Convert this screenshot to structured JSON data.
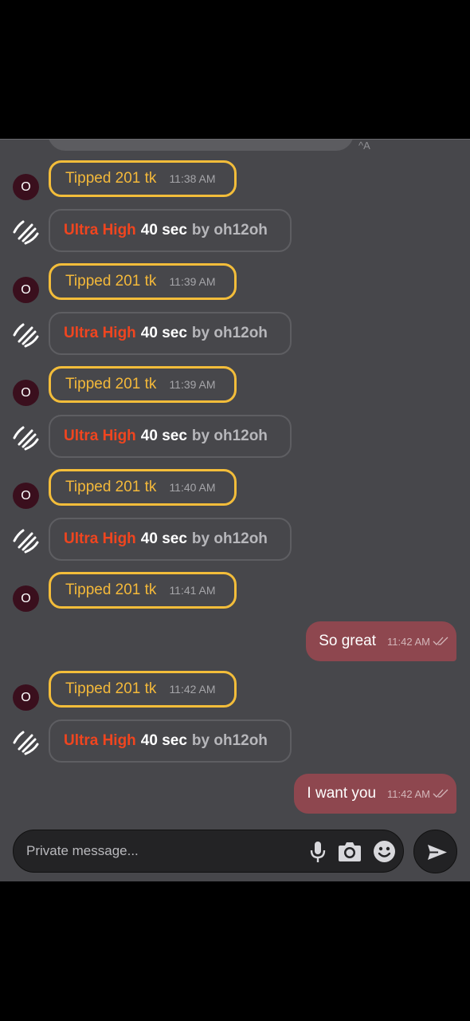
{
  "chat": {
    "top_partial_label": "^A",
    "messages": [
      {
        "kind": "tip",
        "avatar": "O",
        "text": "Tipped 201 tk",
        "time": "11:38 AM"
      },
      {
        "kind": "toy",
        "level": "Ultra High",
        "duration": "40 sec",
        "by": "by oh12oh"
      },
      {
        "kind": "tip",
        "avatar": "O",
        "text": "Tipped 201 tk",
        "time": "11:39 AM"
      },
      {
        "kind": "toy",
        "level": "Ultra High",
        "duration": "40 sec",
        "by": "by oh12oh"
      },
      {
        "kind": "tip",
        "avatar": "O",
        "text": "Tipped 201 tk",
        "time": "11:39 AM"
      },
      {
        "kind": "toy",
        "level": "Ultra High",
        "duration": "40 sec",
        "by": "by oh12oh"
      },
      {
        "kind": "tip",
        "avatar": "O",
        "text": "Tipped 201 tk",
        "time": "11:40 AM"
      },
      {
        "kind": "toy",
        "level": "Ultra High",
        "duration": "40 sec",
        "by": "by oh12oh"
      },
      {
        "kind": "tip",
        "avatar": "O",
        "text": "Tipped 201 tk",
        "time": "11:41 AM"
      },
      {
        "kind": "me",
        "text": "So great",
        "time": "11:42 AM"
      },
      {
        "kind": "tip",
        "avatar": "O",
        "text": "Tipped 201 tk",
        "time": "11:42 AM"
      },
      {
        "kind": "toy",
        "level": "Ultra High",
        "duration": "40 sec",
        "by": "by oh12oh"
      },
      {
        "kind": "me",
        "text": "I want you",
        "time": "11:42 AM"
      }
    ]
  },
  "composer": {
    "placeholder": "Private message...",
    "icons": [
      "microphone-icon",
      "camera-icon",
      "emoji-icon",
      "send-icon"
    ]
  },
  "colors": {
    "chat_bg": "#47474b",
    "tip_border": "#f3bd3a",
    "ultra_level": "#f0451f",
    "my_bubble": "#8e474f"
  }
}
